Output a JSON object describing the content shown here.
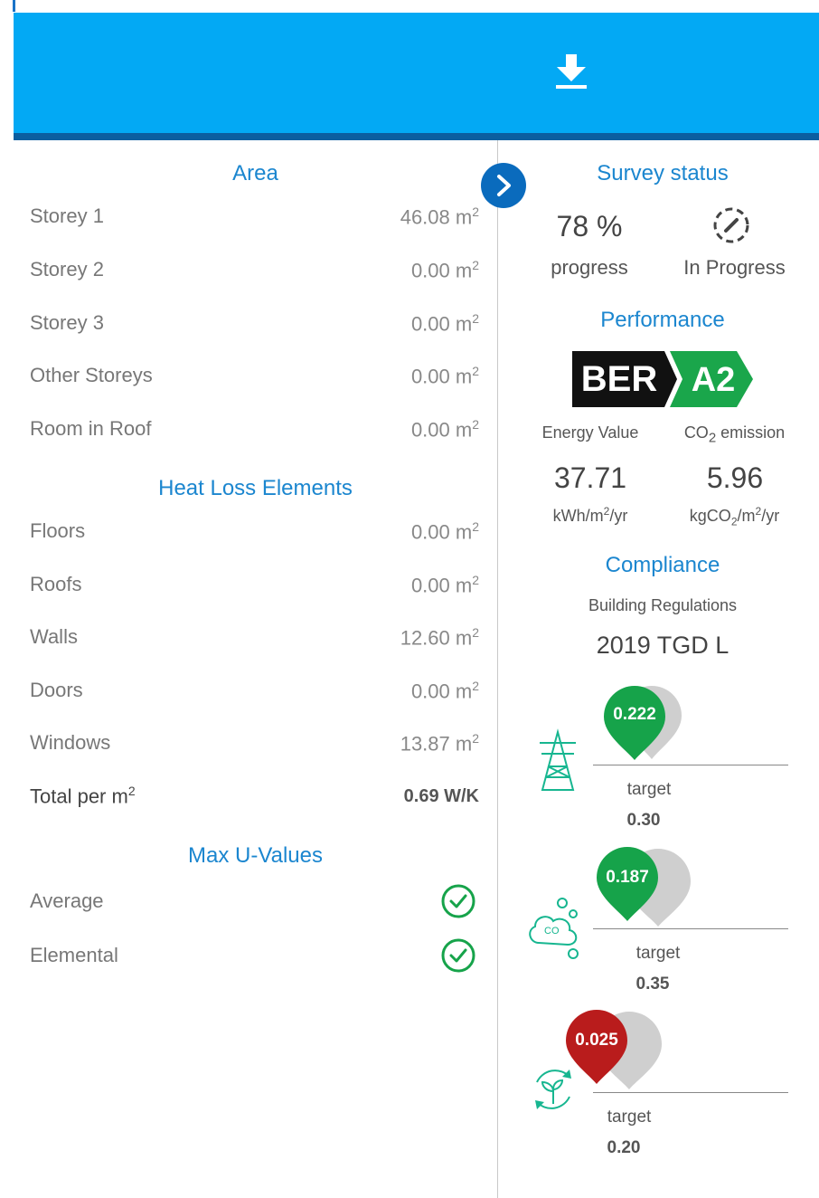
{
  "header": {
    "download_icon": "download-icon",
    "toggle_icon": "chevron-right-icon"
  },
  "left": {
    "area": {
      "title": "Area",
      "rows": [
        {
          "label": "Storey 1",
          "value": "46.08 m",
          "unit_sup": "2"
        },
        {
          "label": "Storey 2",
          "value": "0.00 m",
          "unit_sup": "2"
        },
        {
          "label": "Storey 3",
          "value": "0.00 m",
          "unit_sup": "2"
        },
        {
          "label": "Other Storeys",
          "value": "0.00 m",
          "unit_sup": "2"
        },
        {
          "label": "Room in Roof",
          "value": "0.00 m",
          "unit_sup": "2"
        }
      ]
    },
    "heat_loss": {
      "title": "Heat Loss Elements",
      "rows": [
        {
          "label": "Floors",
          "value": "0.00 m",
          "unit_sup": "2"
        },
        {
          "label": "Roofs",
          "value": "0.00 m",
          "unit_sup": "2"
        },
        {
          "label": "Walls",
          "value": "12.60 m",
          "unit_sup": "2"
        },
        {
          "label": "Doors",
          "value": "0.00 m",
          "unit_sup": "2"
        },
        {
          "label": "Windows",
          "value": "13.87 m",
          "unit_sup": "2"
        }
      ],
      "total_label": "Total per m",
      "total_label_sup": "2",
      "total_value": "0.69 W/K"
    },
    "u_values": {
      "title": "Max U-Values",
      "rows": [
        {
          "label": "Average",
          "status": "check-circle-icon"
        },
        {
          "label": "Elemental",
          "status": "check-circle-icon"
        }
      ]
    }
  },
  "right": {
    "survey": {
      "title": "Survey status",
      "progress_value": "78 %",
      "progress_label": "progress",
      "status_label": "In Progress",
      "status_icon": "edit-progress-icon"
    },
    "performance": {
      "title": "Performance",
      "ber_text": "BER",
      "ber_rating": "A2",
      "ber_color": "#1aa64b",
      "energy_label": "Energy Value",
      "co2_label_main": "CO",
      "co2_label_sub": "2",
      "co2_label_rest": " emission",
      "energy_value": "37.71",
      "co2_value": "5.96",
      "energy_unit": "kWh/m",
      "energy_unit_sup": "2",
      "energy_unit_rest": "/yr",
      "co2_unit_a": "kgCO",
      "co2_unit_sub": "2",
      "co2_unit_b": "/m",
      "co2_unit_sup": "2",
      "co2_unit_rest": "/yr"
    },
    "compliance": {
      "title": "Compliance",
      "subtitle": "Building Regulations",
      "standard": "2019 TGD L",
      "gauges": [
        {
          "icon": "power-pylon-icon",
          "value": "0.222",
          "color": "#16a34a",
          "target_label": "target",
          "target_value": "0.30"
        },
        {
          "icon": "co2-cloud-icon",
          "value": "0.187",
          "color": "#16a34a",
          "target_label": "target",
          "target_value": "0.35"
        },
        {
          "icon": "renewable-leaf-icon",
          "value": "0.025",
          "color": "#b91c1c",
          "target_label": "target",
          "target_value": "0.20"
        }
      ]
    }
  }
}
